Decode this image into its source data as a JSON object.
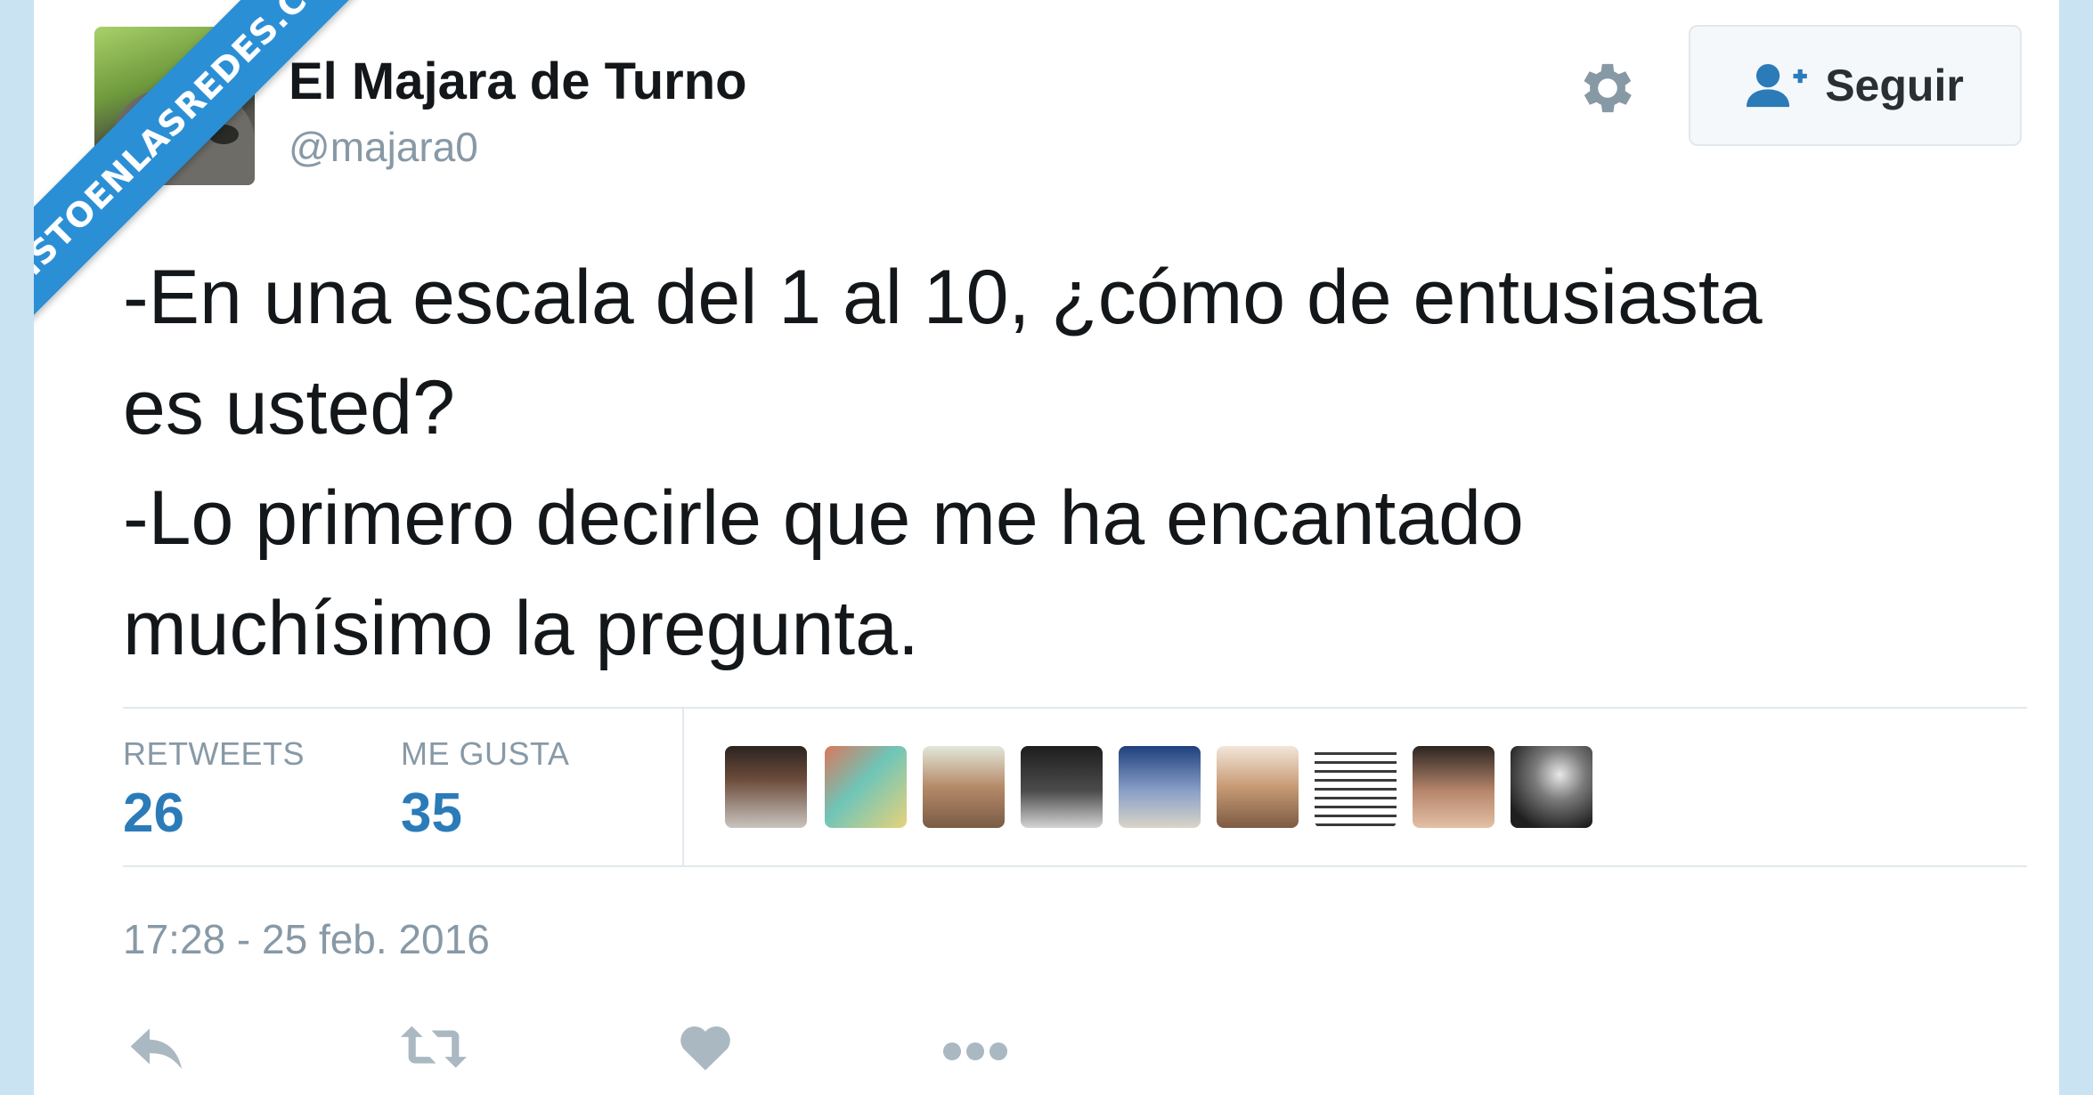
{
  "watermark": {
    "text": "VISTOENLASREDES.COM"
  },
  "header": {
    "display_name": "El Majara de Turno",
    "handle": "@majara0",
    "settings_icon": "gear-icon",
    "follow_button": {
      "label": "Seguir",
      "icon": "follow-user-icon"
    }
  },
  "tweet": {
    "lines": [
      "-En una escala del 1 al 10, ¿cómo de entusiasta",
      "es usted?",
      "-Lo primero decirle que me ha encantado",
      "muchísimo la pregunta."
    ]
  },
  "stats": {
    "retweets_label": "RETWEETS",
    "retweets_count": "26",
    "likes_label": "ME GUSTA",
    "likes_count": "35"
  },
  "likers": [
    {
      "icon": "liker-avatar-1"
    },
    {
      "icon": "liker-avatar-2"
    },
    {
      "icon": "liker-avatar-3"
    },
    {
      "icon": "liker-avatar-4"
    },
    {
      "icon": "liker-avatar-5"
    },
    {
      "icon": "liker-avatar-6"
    },
    {
      "icon": "liker-avatar-7"
    },
    {
      "icon": "liker-avatar-8"
    },
    {
      "icon": "liker-avatar-9"
    }
  ],
  "timestamp": "17:28 - 25 feb. 2016",
  "actions": [
    "reply-icon",
    "retweet-icon",
    "like-icon",
    "more-icon"
  ],
  "colors": {
    "accent": "#2b7bb9",
    "muted": "#8899a6",
    "text": "#14171a",
    "watermark": "#2b8fd6",
    "page_bg": "#c9e3f3"
  }
}
